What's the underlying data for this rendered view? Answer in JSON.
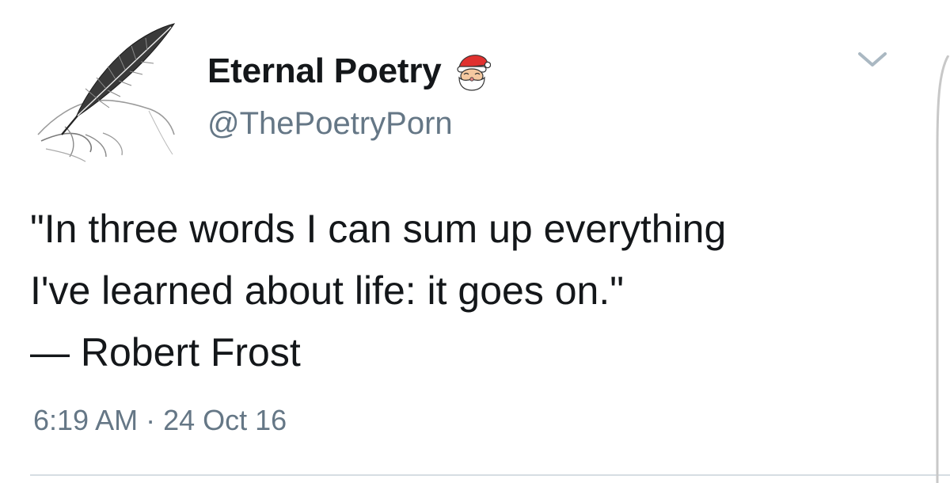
{
  "tweet": {
    "author": {
      "display_name": "Eternal Poetry",
      "handle": "@ThePoetryPorn",
      "avatar_icon": "quill-hand-icon",
      "badge_emoji": "santa-emoji-icon"
    },
    "text_lines": [
      "\"In three words I can sum up everything",
      "I've learned about life: it goes on.\"",
      "— Robert Frost"
    ],
    "timestamp": "6:19 AM · 24 Oct 16",
    "menu_icon": "chevron-down-icon"
  },
  "colors": {
    "text": "#14171a",
    "secondary_text": "#657786",
    "divider": "#d6dde3",
    "chevron": "#aab8c2"
  }
}
